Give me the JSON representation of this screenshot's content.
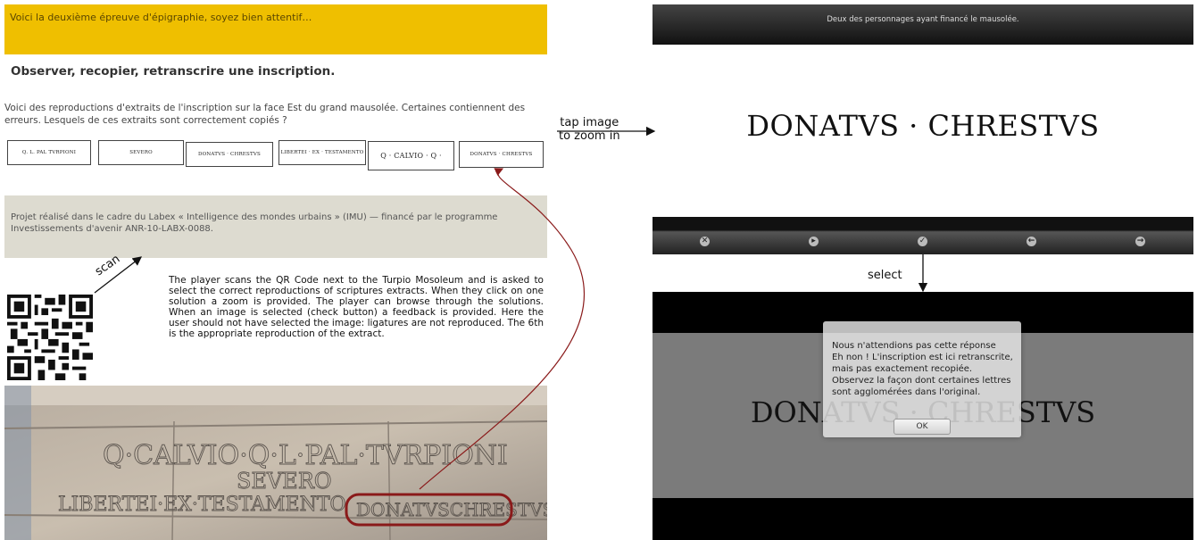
{
  "activity": {
    "banner_text": "Voici la deuxième épreuve d'épigraphie, soyez bien attentif…",
    "title": "Observer, recopier, retranscrire une inscription.",
    "intro": "Voici des reproductions d'extraits de l'inscription sur la face Est du grand mausolée. Certaines contiennent des erreurs. Lesquels de ces extraits sont correctement copiés ?",
    "thumbnails": [
      "Q. L. PAL TVRPIONI",
      "SEVERO",
      "DONATVS · CHRESTVS",
      "LIBERTEI · EX · TESTAMENTO",
      "Q · CALVIO · Q ·",
      "DONATVS · CHRESTVS"
    ],
    "footer": "Projet réalisé dans le cadre du Labex « Intelligence des mondes urbains » (IMU) — financé par le programme Investissements d'avenir ANR-10-LABX-0088."
  },
  "annotations": {
    "scan": "scan",
    "tap_line1": "tap image",
    "tap_line2": "to zoom in",
    "select": "select",
    "description": "The player scans the QR Code next to the Turpio Mosoleum and is asked to select the correct reproductions of scriptures extracts. When they click on one solution a zoom is provided. The player can browse through the solutions. When an image is selected (check button) a feedback is provided. Here the user should not have selected the image: ligatures are not reproduced. The 6th is the appropriate reproduction of the extract.",
    "arrow_color": "#8a1a1a"
  },
  "zoom": {
    "caption": "Deux des personnages ayant financé le mausolée.",
    "inscription": "DONATVS · CHRESTVS",
    "toolbar_icons": [
      "close-icon",
      "play-icon",
      "check-icon",
      "previous-icon",
      "next-icon"
    ]
  },
  "feedback": {
    "inscription": "DONATVS · CHRESTVS",
    "line1": "Nous n'attendions pas cette réponse",
    "line2": "Eh non ! L'inscription est ici retranscrite, mais pas exactement recopiée.",
    "line3": "Observez la façon dont certaines lettres sont agglomérées dans l'original.",
    "ok": "OK"
  },
  "photo": {
    "inscription_lines": [
      "Q·CALVIO·Q·L·PAL·TVRPIONI",
      "SEVERO",
      "LIBERTEI·EX·TESTAMENTO",
      "DONATVSCHRESTVS"
    ]
  }
}
